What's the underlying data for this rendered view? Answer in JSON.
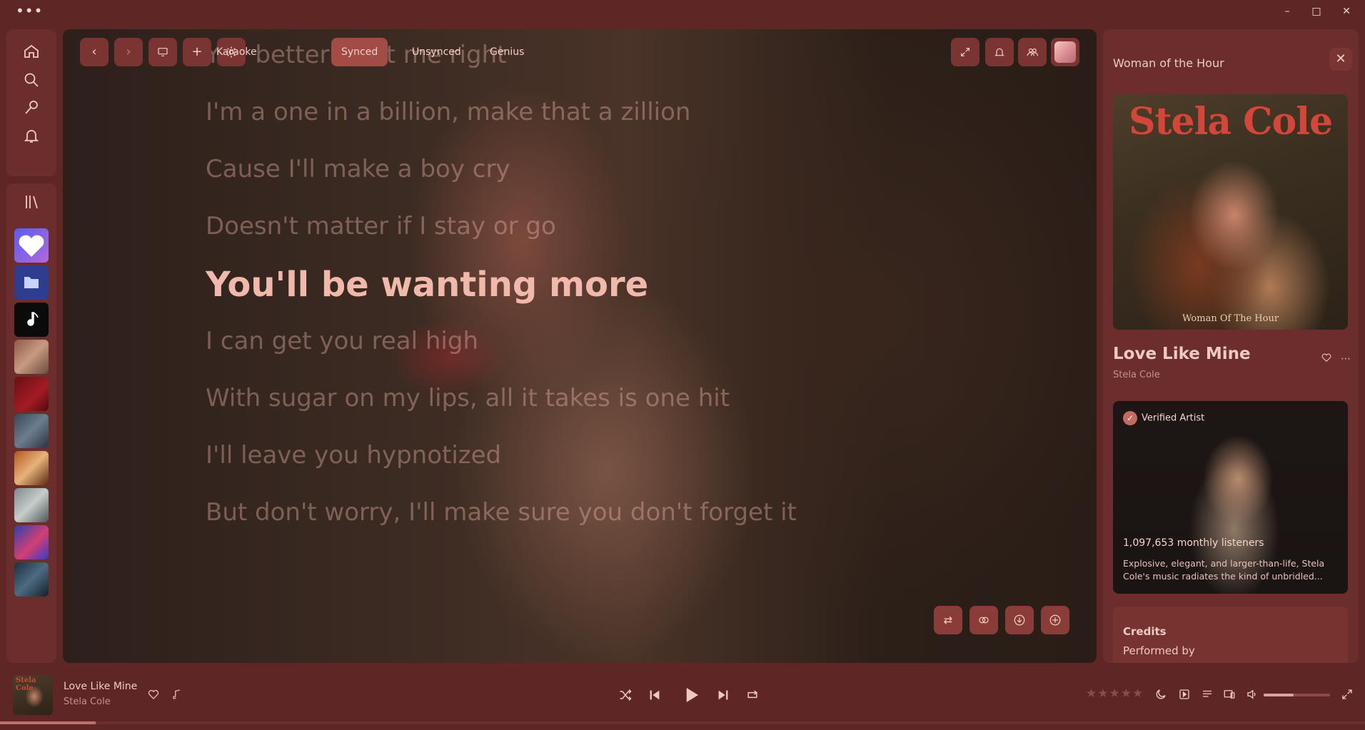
{
  "window": {
    "menu_label": "•••",
    "minimize": "–",
    "maximize": "□",
    "close": "✕"
  },
  "stage": {
    "tabs": [
      {
        "label": "Karaoke",
        "active": false
      },
      {
        "label": "Synced",
        "active": true
      },
      {
        "label": "Unsynced",
        "active": false
      },
      {
        "label": "Genius",
        "active": false
      }
    ],
    "lyrics": [
      {
        "text": "You better treat me right",
        "active": false
      },
      {
        "text": "I'm a one in a billion, make that a zillion",
        "active": false
      },
      {
        "text": "Cause I'll make a boy cry",
        "active": false
      },
      {
        "text": "Doesn't matter if I stay or go",
        "active": false
      },
      {
        "text": "You'll be wanting more",
        "active": true
      },
      {
        "text": "I can get you real high",
        "active": false
      },
      {
        "text": "With sugar on my lips, all it takes is one hit",
        "active": false
      },
      {
        "text": "I'll leave you hypnotized",
        "active": false
      },
      {
        "text": "But don't worry, I'll make sure you don't forget it",
        "active": false
      }
    ]
  },
  "right_panel": {
    "title": "Woman of the Hour",
    "cover": {
      "artist_text": "Stela Cole",
      "album_text": "Woman Of The Hour"
    },
    "song_title": "Love Like Mine",
    "song_artist": "Stela Cole",
    "artist_card": {
      "verified_label": "Verified Artist",
      "monthly_listeners": "1,097,653 monthly listeners",
      "bio": "Explosive, elegant, and larger-than-life, Stela Cole's music radiates the kind of unbridled..."
    },
    "credits": {
      "title": "Credits",
      "performed_by": "Performed by"
    }
  },
  "player": {
    "cover_text": "Stela Cole",
    "title": "Love Like Mine",
    "artist": "Stela Cole",
    "progress": 0.07,
    "volume": 0.45,
    "rating_stars": 0,
    "rating_max": 5
  },
  "colors": {
    "background": "#5e2624",
    "panel": "#6b2e2c",
    "button": "#7a3532",
    "accent_active_tab": "#a24c45",
    "lyric_active": "#f1b9ab",
    "text": "#f1c9c3"
  }
}
